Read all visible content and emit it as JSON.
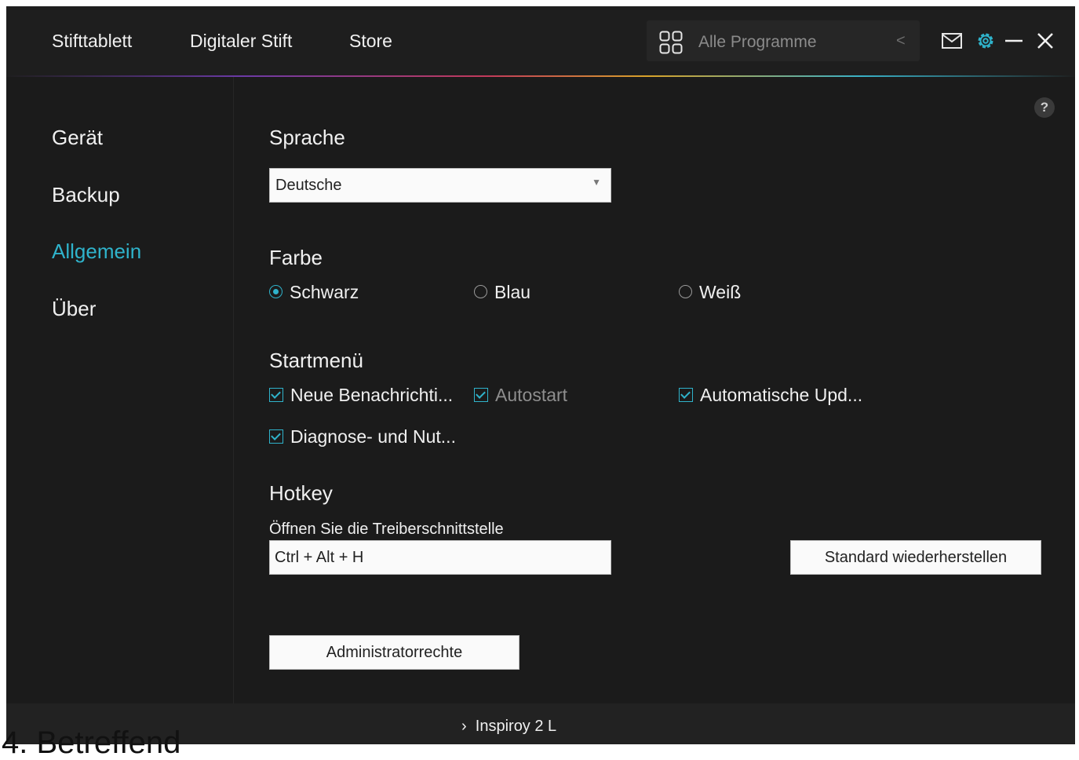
{
  "topnav": {
    "items": [
      "Stifttablett",
      "Digitaler Stift",
      "Store"
    ]
  },
  "program_selector": {
    "label": "Alle Programme",
    "icon": "grid-icon",
    "chevron": "<"
  },
  "window_controls": {
    "mail_icon": "mail-icon",
    "settings_icon": "gear-icon",
    "minimize_icon": "minimize-icon",
    "close_icon": "close-icon"
  },
  "sidebar": {
    "items": [
      {
        "label": "Gerät",
        "active": false
      },
      {
        "label": "Backup",
        "active": false
      },
      {
        "label": "Allgemein",
        "active": true
      },
      {
        "label": "Über",
        "active": false
      }
    ]
  },
  "help": {
    "label": "?"
  },
  "language": {
    "title": "Sprache",
    "selected": "Deutsche"
  },
  "color": {
    "title": "Farbe",
    "options": [
      {
        "label": "Schwarz",
        "checked": true
      },
      {
        "label": "Blau",
        "checked": false
      },
      {
        "label": "Weiß",
        "checked": false
      }
    ]
  },
  "startmenu": {
    "title": "Startmenü",
    "options": [
      {
        "label": "Neue Benachrichti...",
        "checked": true,
        "enabled": true
      },
      {
        "label": "Autostart",
        "checked": true,
        "enabled": false
      },
      {
        "label": "Automatische Upd...",
        "checked": true,
        "enabled": true
      },
      {
        "label": "Diagnose- und Nut...",
        "checked": true,
        "enabled": true
      }
    ]
  },
  "hotkey": {
    "title": "Hotkey",
    "sublabel": "Öffnen Sie die Treiberschnittstelle",
    "value": "Ctrl + Alt + H",
    "restore_button": "Standard wiederherstellen"
  },
  "admin_button": "Administratorrechte",
  "footer": {
    "device": "Inspiroy 2 L"
  },
  "outside_text": "4. Betreffend",
  "colors": {
    "accent": "#2fb3cb",
    "background": "#1b1b1b"
  }
}
